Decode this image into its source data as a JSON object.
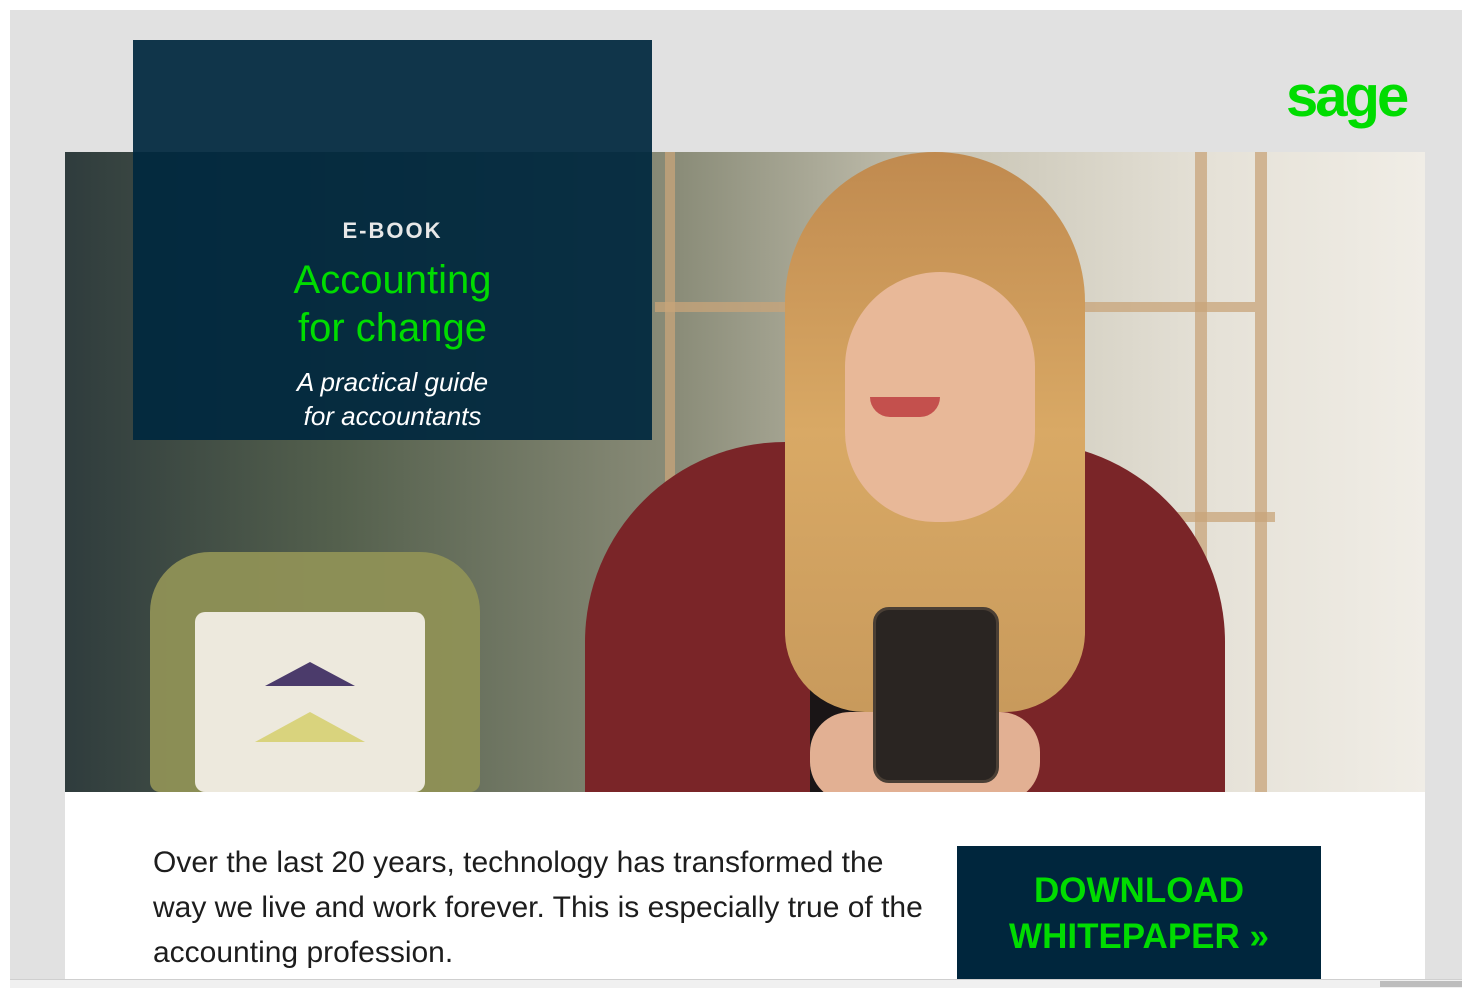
{
  "brand": {
    "logo": "sage",
    "accent_color": "#00dc00",
    "dark_color": "#00263d"
  },
  "ebook": {
    "kicker": "E-BOOK",
    "title_line1": "Accounting",
    "title_line2": "for change",
    "subtitle_line1": "A practical guide",
    "subtitle_line2": "for accountants"
  },
  "body": {
    "intro": "Over the last 20 years, technology has transformed the way we live and work forever. This is especially true of the accounting profession."
  },
  "cta": {
    "line1": "DOWNLOAD",
    "line2": "WHITEPAPER »"
  }
}
